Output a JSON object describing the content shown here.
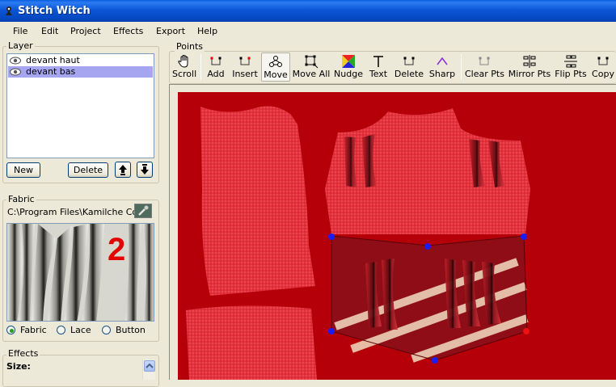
{
  "window": {
    "title": "Stitch Witch"
  },
  "menu": [
    "File",
    "Edit",
    "Project",
    "Effects",
    "Export",
    "Help"
  ],
  "layer_panel": {
    "label": "Layer",
    "items": [
      {
        "name": "devant haut",
        "selected": false
      },
      {
        "name": "devant bas",
        "selected": true
      }
    ],
    "new_label": "New",
    "delete_label": "Delete",
    "up_icon": "arrow-up-icon",
    "down_icon": "arrow-down-icon"
  },
  "fabric_panel": {
    "label": "Fabric",
    "path": "C:\\Program Files\\Kamilche Co\\Stitching",
    "preview_number": "2",
    "picker_icon": "eyedropper-icon",
    "types": [
      {
        "label": "Fabric",
        "checked": true
      },
      {
        "label": "Lace",
        "checked": false
      },
      {
        "label": "Button",
        "checked": false
      }
    ]
  },
  "effects_panel": {
    "label": "Effects",
    "size_label": "Size:"
  },
  "points_panel": {
    "label": "Points",
    "tools": [
      {
        "label": "Scroll",
        "icon": "hand-icon",
        "active": false
      },
      {
        "label": "Add",
        "icon": "add-point-icon",
        "active": false
      },
      {
        "label": "Insert",
        "icon": "insert-point-icon",
        "active": false
      },
      {
        "label": "Move",
        "icon": "move-icon",
        "active": true
      },
      {
        "label": "Move All",
        "icon": "move-all-icon",
        "active": false
      },
      {
        "label": "Nudge",
        "icon": "nudge-icon",
        "active": false
      },
      {
        "label": "Text",
        "icon": "text-icon",
        "active": false
      },
      {
        "label": "Delete",
        "icon": "delete-point-icon",
        "active": false
      },
      {
        "label": "Sharp",
        "icon": "sharp-icon",
        "active": false
      },
      {
        "label": "Clear Pts",
        "icon": "clear-points-icon",
        "active": false
      },
      {
        "label": "Mirror Pts",
        "icon": "mirror-points-icon",
        "active": false
      },
      {
        "label": "Flip Pts",
        "icon": "flip-points-icon",
        "active": false
      },
      {
        "label": "Copy",
        "icon": "copy-icon",
        "active": false
      }
    ]
  },
  "colors": {
    "canvas_background": "#b5000a",
    "fabric_red": "#e0323e",
    "selected_layer": "#a6a6f0",
    "control_point": "#1c1cf0",
    "control_point_end": "#ee1111"
  }
}
